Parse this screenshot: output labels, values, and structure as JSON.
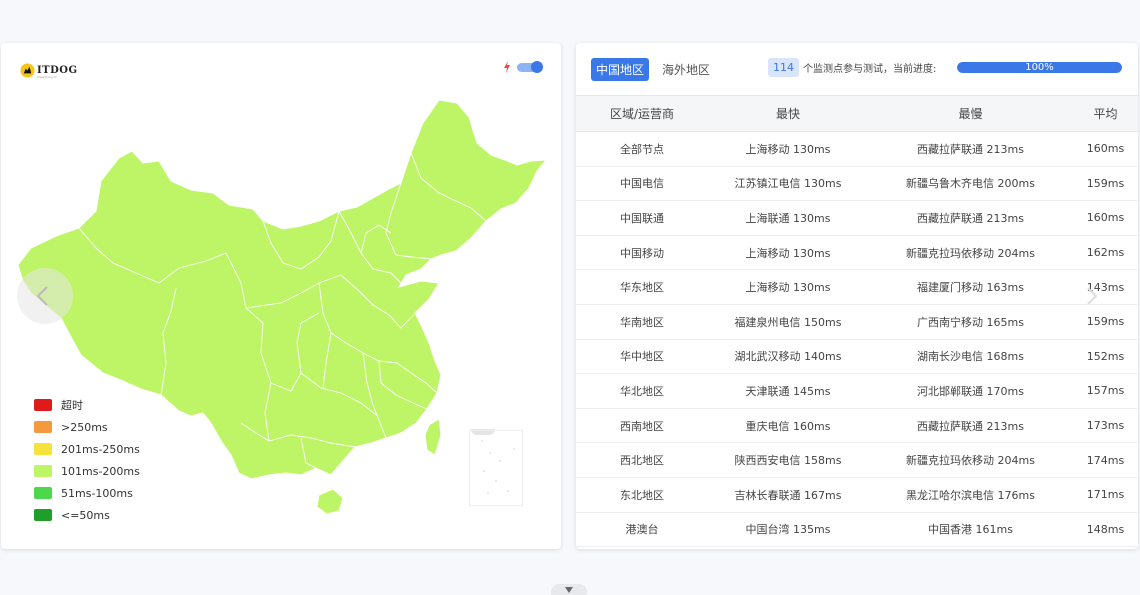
{
  "map": {
    "logo_text": "ITDOG",
    "logo_sub": "www.itdog.cn",
    "toggle_on": true,
    "fill_color": "#bef566",
    "border_color": "#ffffff",
    "legend": [
      {
        "label": "超时",
        "color": "#e01a1a"
      },
      {
        "label": ">250ms",
        "color": "#f59a3c"
      },
      {
        "label": "201ms-250ms",
        "color": "#f5e23c"
      },
      {
        "label": "101ms-200ms",
        "color": "#bef566"
      },
      {
        "label": "51ms-100ms",
        "color": "#4cd84a"
      },
      {
        "label": "<=50ms",
        "color": "#1f9e2a"
      }
    ]
  },
  "tabs": [
    {
      "label": "中国地区",
      "active": true
    },
    {
      "label": "海外地区",
      "active": false
    }
  ],
  "probe": {
    "count": "114",
    "text": "个监测点参与测试，当前进度:",
    "progress_label": "100%",
    "progress_value": 100
  },
  "table": {
    "headers": [
      "区域/运营商",
      "最快",
      "最慢",
      "平均"
    ],
    "rows": [
      [
        "全部节点",
        "上海移动 130ms",
        "西藏拉萨联通 213ms",
        "160ms"
      ],
      [
        "中国电信",
        "江苏镇江电信 130ms",
        "新疆乌鲁木齐电信 200ms",
        "159ms"
      ],
      [
        "中国联通",
        "上海联通 130ms",
        "西藏拉萨联通 213ms",
        "160ms"
      ],
      [
        "中国移动",
        "上海移动 130ms",
        "新疆克拉玛依移动 204ms",
        "162ms"
      ],
      [
        "华东地区",
        "上海移动 130ms",
        "福建厦门移动 163ms",
        "143ms"
      ],
      [
        "华南地区",
        "福建泉州电信 150ms",
        "广西南宁移动 165ms",
        "159ms"
      ],
      [
        "华中地区",
        "湖北武汉移动 140ms",
        "湖南长沙电信 168ms",
        "152ms"
      ],
      [
        "华北地区",
        "天津联通 145ms",
        "河北邯郸联通 170ms",
        "157ms"
      ],
      [
        "西南地区",
        "重庆电信 160ms",
        "西藏拉萨联通 213ms",
        "173ms"
      ],
      [
        "西北地区",
        "陕西西安电信 158ms",
        "新疆克拉玛依移动 204ms",
        "174ms"
      ],
      [
        "东北地区",
        "吉林长春联通 167ms",
        "黑龙江哈尔滨电信 176ms",
        "171ms"
      ],
      [
        "港澳台",
        "中国台湾 135ms",
        "中国香港 161ms",
        "148ms"
      ]
    ]
  }
}
